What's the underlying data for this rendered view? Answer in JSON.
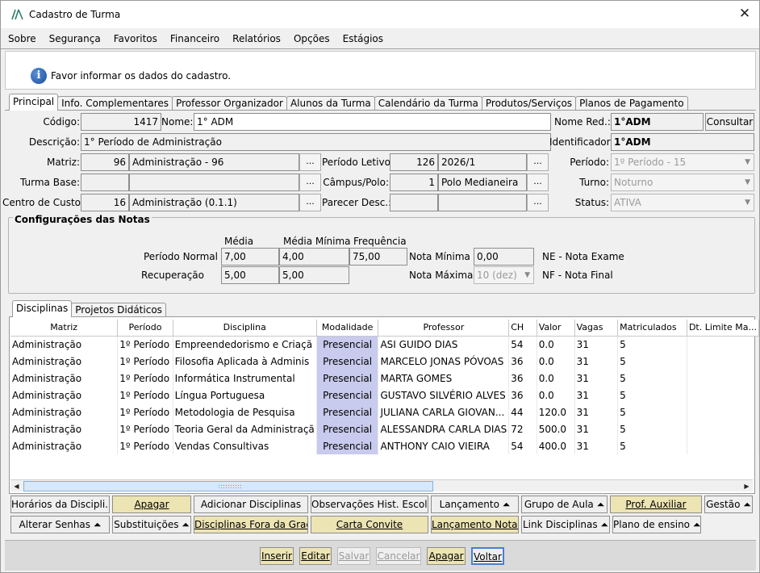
{
  "window": {
    "title": "Cadastro de Turma",
    "close_glyph": "✕"
  },
  "menu": [
    "Sobre",
    "Segurança",
    "Favoritos",
    "Financeiro",
    "Relatórios",
    "Opções",
    "Estágios"
  ],
  "info": {
    "message": "Favor informar os dados do cadastro."
  },
  "main_tabs": [
    "Principal",
    "Info. Complementares",
    "Professor Organizador",
    "Alunos da Turma",
    "Calendário da Turma",
    "Produtos/Serviços",
    "Planos de Pagamento"
  ],
  "form": {
    "codigo_label": "Código:",
    "codigo": "1417",
    "nome_label": "Nome:",
    "nome": "1° ADM",
    "nome_red_label": "Nome Red.:",
    "nome_red": "1°ADM",
    "consultar": "Consultar",
    "descricao_label": "Descrição:",
    "descricao": "1° Período de Administração",
    "identificador_label": "Identificador:",
    "identificador": "1°ADM",
    "matriz_label": "Matriz:",
    "matriz_code": "96",
    "matriz_name": "Administração - 96",
    "periodo_letivo_label": "Período Letivo:",
    "periodo_letivo_code": "126",
    "periodo_letivo_name": "2026/1",
    "periodo_label": "Período:",
    "periodo": "1º Período - 15",
    "turma_base_label": "Turma Base:",
    "turma_base_code": "",
    "turma_base_name": "",
    "campus_label": "Câmpus/Polo:",
    "campus_code": "1",
    "campus_name": "Polo Medianeira",
    "turno_label": "Turno:",
    "turno": "Noturno",
    "centro_custo_label": "Centro de Custo:",
    "centro_custo_code": "16",
    "centro_custo_name": "Administração (0.1.1)",
    "parecer_label": "Parecer Desc.:",
    "parecer_code": "",
    "parecer_name": "",
    "status_label": "Status:",
    "status": "ATIVA",
    "ellipsis": "..."
  },
  "notas": {
    "title": "Configurações das Notas",
    "col_media": "Média",
    "col_media_minima": "Média Mínima",
    "col_frequencia": "Frequência",
    "periodo_normal_label": "Período Normal",
    "pn_media": "7,00",
    "pn_media_minima": "4,00",
    "pn_frequencia": "75,00",
    "recuperacao_label": "Recuperação",
    "rec_media": "5,00",
    "rec_media_minima": "5,00",
    "nota_minima_label": "Nota Mínima",
    "nota_minima": "0,00",
    "nota_maxima_label": "Nota Máxima",
    "nota_maxima": "10 (dez)",
    "ne_legend": "NE - Nota Exame",
    "nf_legend": "NF - Nota Final"
  },
  "sub_tabs": [
    "Disciplinas",
    "Projetos Didáticos"
  ],
  "table": {
    "headers": [
      "Matriz",
      "Período",
      "Disciplina",
      "Modalidade",
      "Professor",
      "CH",
      "Valor",
      "Vagas",
      "Matriculados",
      "Dt. Limite Ma..."
    ],
    "rows": [
      [
        "Administração",
        "1º Período",
        "Empreendedorismo e Criaçã",
        "Presencial",
        "ASI GUIDO DIAS",
        "54",
        "0.0",
        "31",
        "5",
        ""
      ],
      [
        "Administração",
        "1º Período",
        "Filosofia Aplicada à Adminis",
        "Presencial",
        "MARCELO JONAS PÓVOAS",
        "36",
        "0.0",
        "31",
        "5",
        ""
      ],
      [
        "Administração",
        "1º Período",
        "Informática Instrumental",
        "Presencial",
        "MARTA GOMES",
        "36",
        "0.0",
        "31",
        "5",
        ""
      ],
      [
        "Administração",
        "1º Período",
        "Língua Portuguesa",
        "Presencial",
        "GUSTAVO SILVÉRIO ALVES",
        "36",
        "0.0",
        "31",
        "5",
        ""
      ],
      [
        "Administração",
        "1º Período",
        "Metodologia de Pesquisa",
        "Presencial",
        "JULIANA CARLA GIOVAN...",
        "44",
        "120.0",
        "31",
        "5",
        ""
      ],
      [
        "Administração",
        "1º Período",
        "Teoria Geral da Administraçã",
        "Presencial",
        "ALESSANDRA CARLA DIAS",
        "72",
        "500.0",
        "31",
        "5",
        ""
      ],
      [
        "Administração",
        "1º Período",
        "Vendas Consultivas",
        "Presencial",
        "ANTHONY CAIO VIEIRA",
        "54",
        "400.0",
        "31",
        "5",
        ""
      ]
    ]
  },
  "action_row1": [
    "Horários da Discipli...",
    "Apagar",
    "Adicionar Disciplinas",
    "Observações Hist. Escolar",
    "Lançamento ⏶",
    "Grupo de Aula ⏶",
    "Prof. Auxiliar",
    "Gestão ⏶"
  ],
  "action_row2": [
    "Alterar Senhas ⏶",
    "Substituições ⏶",
    "Disciplinas Fora da Grade",
    "Carta Convite",
    "Lançamento Notas",
    "Link Disciplinas ⏶",
    "Plano de ensino ⏶"
  ],
  "bottom": [
    "Inserir",
    "Editar",
    "Salvar",
    "Cancelar",
    "Apagar",
    "Voltar"
  ],
  "colors": {
    "highlight_button": "#ede4b4",
    "modalidade_cell": "#c8cbed"
  }
}
